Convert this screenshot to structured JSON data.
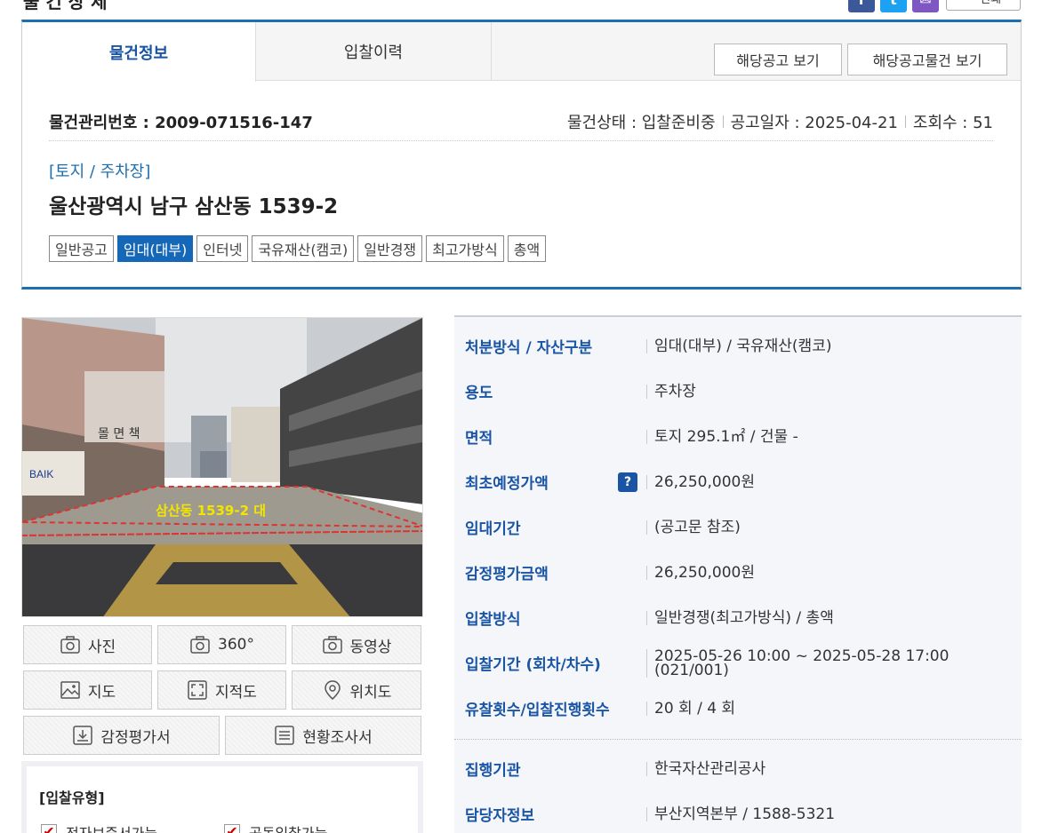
{
  "header": {
    "title_partial": "물 건 상 세",
    "print_label": "인쇄"
  },
  "social": {
    "facebook": "f",
    "twitter": "t",
    "mail": "✉"
  },
  "tabs": [
    {
      "label": "물건정보",
      "active": true
    },
    {
      "label": "입찰이력",
      "active": false
    }
  ],
  "buttons": {
    "notice": "해당공고 보기",
    "notice_items": "해당공고물건 보기"
  },
  "item": {
    "id_label": "물건관리번호 : 2009-071516-147",
    "status": "물건상태 : 입찰준비중",
    "notice_date": "공고일자 : 2025-04-21",
    "views": "조회수 : 51",
    "category": "[토지 / 주차장]",
    "address": "울산광역시 남구 삼산동 1539-2"
  },
  "tags": [
    "일반공고",
    "임대(대부)",
    "인터넷",
    "국유재산(캠코)",
    "일반경쟁",
    "최고가방식",
    "총액"
  ],
  "active_tag_index": 1,
  "photo": {
    "overlay_text": "삼산동 1539-2 대",
    "left_sign": "BAIK",
    "shop_sign": "몰 면 책"
  },
  "media": {
    "photo": "사진",
    "deg360": "360°",
    "video": "동영상",
    "map": "지도",
    "cadastral": "지적도",
    "location": "위치도",
    "appraisal": "감정평가서",
    "survey": "현황조사서"
  },
  "bid_type": {
    "title": "[입찰유형]",
    "options": [
      "전자보증서가능",
      "공동입찰가능"
    ]
  },
  "details": [
    {
      "label": "처분방식 / 자산구분",
      "value": "임대(대부) / 국유재산(캠코)"
    },
    {
      "label": "용도",
      "value": "주차장"
    },
    {
      "label": "면적",
      "value": "토지 295.1㎡ / 건물 -"
    },
    {
      "label": "최초예정가액",
      "value": "26,250,000원",
      "help": "?"
    },
    {
      "label": "임대기간",
      "value": "(공고문 참조)"
    },
    {
      "label": "감정평가금액",
      "value": "26,250,000원"
    },
    {
      "label": "입찰방식",
      "value": "일반경쟁(최고가방식) / 총액"
    },
    {
      "label": "입찰기간 (회차/차수)",
      "value": "2025-05-26 10:00 ~ 2025-05-28 17:00 (021/001)"
    },
    {
      "label": "유찰횟수/입찰진행횟수",
      "value": "20 회 / 4 회"
    },
    {
      "label": "집행기관",
      "value": "한국자산관리공사"
    },
    {
      "label": "담당자정보",
      "value": "부산지역본부 / 1588-5321"
    }
  ],
  "colors": {
    "accent": "#1e6fb0",
    "label_blue": "#1a55a5",
    "tag_active": "#1567b8"
  }
}
